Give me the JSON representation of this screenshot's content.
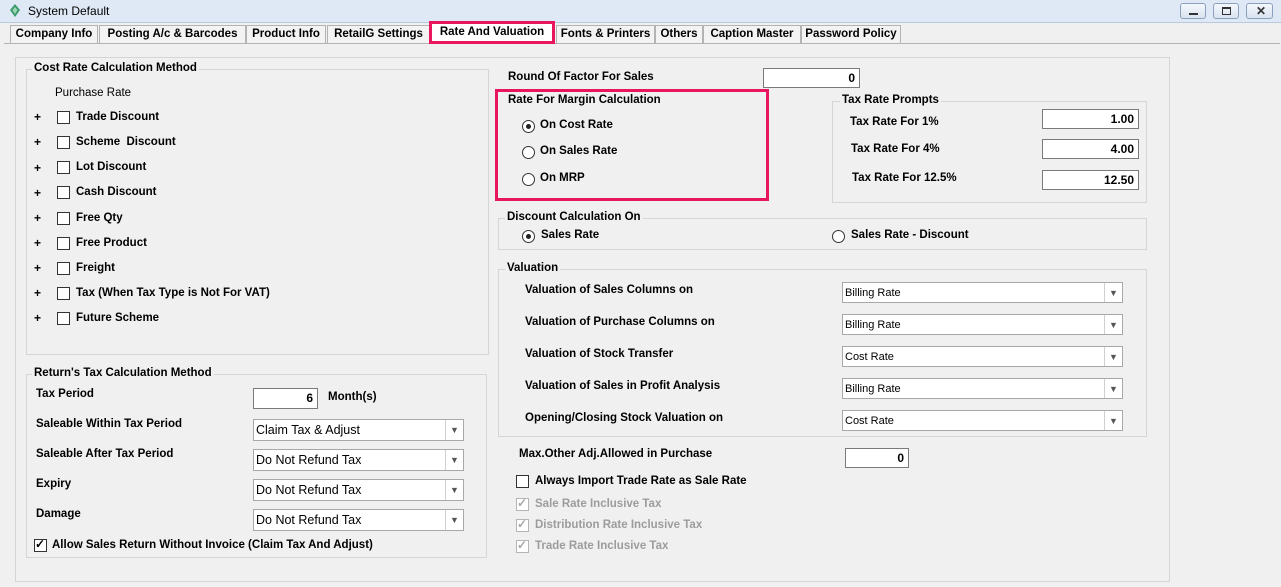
{
  "window": {
    "title": "System Default"
  },
  "tabs": [
    "Company Info",
    "Posting A/c & Barcodes",
    "Product Info",
    "RetailG Settings",
    "Rate And Valuation",
    "Fonts & Printers",
    "Others",
    "Caption Master",
    "Password Policy"
  ],
  "active_tab": "Rate And Valuation",
  "cost_rate": {
    "title": "Cost Rate Calculation Method",
    "subtitle": "Purchase Rate",
    "items": [
      "Trade Discount",
      "Scheme  Discount",
      "Lot Discount",
      "Cash Discount",
      "Free Qty",
      "Free Product",
      "Freight",
      "Tax (When Tax Type is Not For VAT)",
      "Future Scheme"
    ]
  },
  "returns": {
    "title": "Return's Tax Calculation Method",
    "tax_period_label": "Tax Period",
    "tax_period_value": "6",
    "tax_period_unit": "Month(s)",
    "rows": [
      {
        "label": "Saleable  Within Tax Period",
        "value": "Claim Tax & Adjust"
      },
      {
        "label": "Saleable  After Tax Period",
        "value": "Do Not Refund Tax"
      },
      {
        "label": "Expiry",
        "value": "Do Not Refund Tax"
      },
      {
        "label": "Damage",
        "value": "Do Not Refund Tax"
      }
    ],
    "allow_label": "Allow Sales Return Without Invoice (Claim Tax And Adjust)"
  },
  "round_factor": {
    "label": "Round Of Factor For Sales",
    "value": "0"
  },
  "margin": {
    "title": "Rate For Margin Calculation",
    "options": [
      "On Cost Rate",
      "On Sales Rate",
      "On MRP"
    ],
    "selected": "On Cost Rate"
  },
  "tax_prompts": {
    "title": "Tax Rate Prompts",
    "rows": [
      {
        "label": "Tax Rate For 1%",
        "value": "1.00"
      },
      {
        "label": "Tax Rate For 4%",
        "value": "4.00"
      },
      {
        "label": "Tax Rate For 12.5%",
        "value": "12.50"
      }
    ]
  },
  "discount": {
    "title": "Discount Calculation On",
    "options": [
      "Sales Rate",
      "Sales Rate - Discount"
    ],
    "selected": "Sales Rate"
  },
  "valuation": {
    "title": "Valuation",
    "rows": [
      {
        "label": "Valuation of Sales Columns on",
        "value": "Billing Rate"
      },
      {
        "label": "Valuation of Purchase Columns on",
        "value": "Billing Rate"
      },
      {
        "label": "Valuation of Stock Transfer",
        "value": "Cost Rate"
      },
      {
        "label": "Valuation of Sales in Profit Analysis",
        "value": "Billing Rate"
      },
      {
        "label": "Opening/Closing Stock Valuation on",
        "value": "Cost Rate"
      }
    ]
  },
  "max_adj": {
    "label": "Max.Other Adj.Allowed in Purchase",
    "value": "0"
  },
  "import_trade": {
    "label": "Always Import Trade Rate as Sale Rate"
  },
  "inclusive": [
    "Sale Rate Inclusive Tax",
    "Distribution Rate Inclusive Tax",
    "Trade Rate Inclusive Tax"
  ],
  "colors": {
    "highlight": "#e8155f",
    "titlebar": "#dfe9f5"
  }
}
